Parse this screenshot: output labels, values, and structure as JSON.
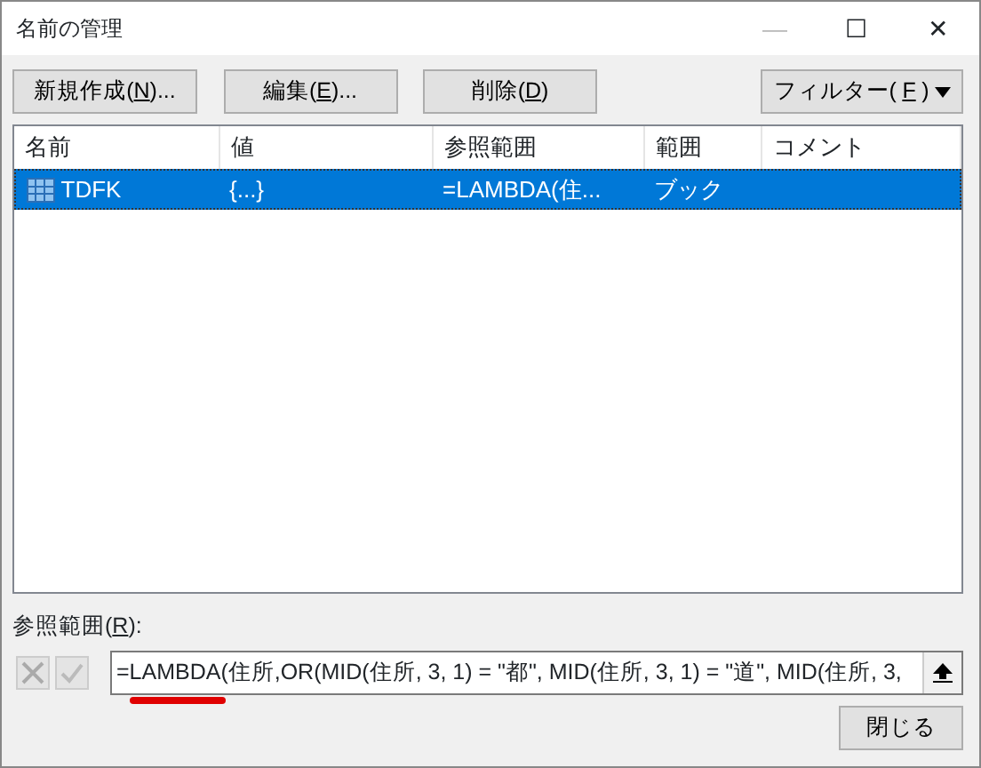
{
  "window": {
    "title": "名前の管理",
    "controls": [
      "—",
      "☐",
      "✕"
    ]
  },
  "buttons": [
    {
      "before": "新規作成(",
      "key": "N",
      "after": ")..."
    },
    {
      "before": "編集(",
      "key": "E",
      "after": ")..."
    },
    {
      "before": "削除(",
      "key": "D",
      "after": ")"
    }
  ],
  "filter_button": {
    "before": "フィルター(",
    "key": "F",
    "after": ")"
  },
  "table": {
    "columns": [
      "名前",
      "値",
      "参照範囲",
      "範囲",
      "コメント"
    ],
    "rows": [
      {
        "cells": [
          "TDFK",
          "{...}",
          "=LAMBDA(住...",
          "ブック",
          ""
        ],
        "selected": true
      }
    ]
  },
  "refers_to": {
    "label": {
      "before": "参照範囲(",
      "key": "R",
      "after": "):"
    },
    "value": "=LAMBDA(住所,OR(MID(住所, 3, 1) = \"都\", MID(住所, 3, 1) = \"道\", MID(住所, 3,"
  },
  "close_button": "閉じる"
}
